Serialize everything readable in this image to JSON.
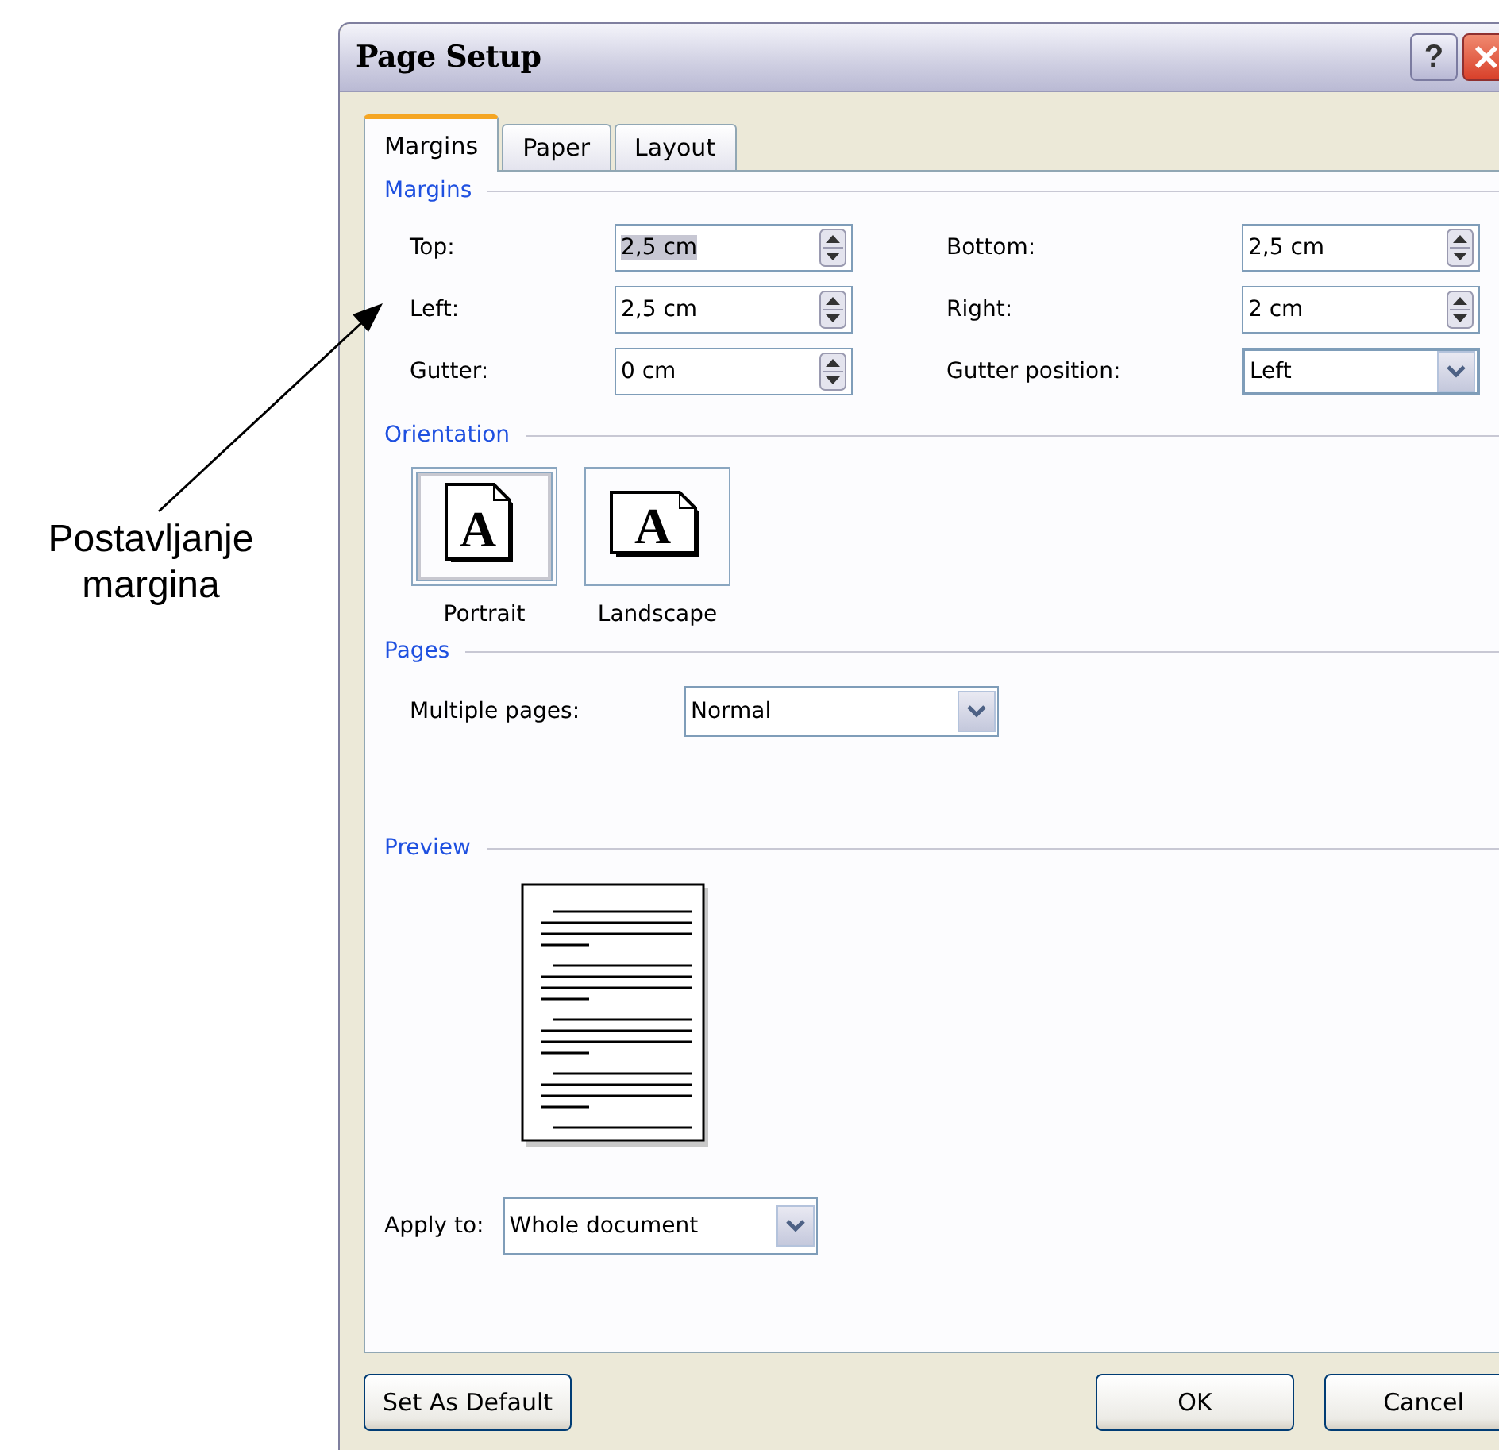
{
  "window": {
    "title": "Page Setup",
    "help_button": "?"
  },
  "tabs": [
    {
      "label": "Margins",
      "selected": true
    },
    {
      "label": "Paper",
      "selected": false
    },
    {
      "label": "Layout",
      "selected": false
    }
  ],
  "margins": {
    "title": "Margins",
    "fields": [
      {
        "label": "Top:",
        "value": "2,5 cm",
        "kind": "spin",
        "highlighted": true
      },
      {
        "label": "Bottom:",
        "value": "2,5 cm",
        "kind": "spin",
        "highlighted": false
      },
      {
        "label": "Left:",
        "value": "2,5 cm",
        "kind": "spin",
        "highlighted": false
      },
      {
        "label": "Right:",
        "value": "2 cm",
        "kind": "spin",
        "highlighted": false
      },
      {
        "label": "Gutter:",
        "value": "0 cm",
        "kind": "spin",
        "highlighted": false
      },
      {
        "label": "Gutter position:",
        "value": "Left",
        "kind": "dropdown",
        "highlighted": false
      }
    ]
  },
  "orientation": {
    "title": "Orientation",
    "options": [
      {
        "label": "Portrait",
        "icon_letter": "A",
        "kind": "portrait",
        "selected": true
      },
      {
        "label": "Landscape",
        "icon_letter": "A",
        "kind": "landscape",
        "selected": false
      }
    ]
  },
  "pages": {
    "title": "Pages",
    "label": "Multiple pages:",
    "value": "Normal"
  },
  "preview": {
    "title": "Preview"
  },
  "apply_to": {
    "label": "Apply to:",
    "value": "Whole document"
  },
  "buttons": [
    {
      "label": "Set As Default",
      "kind": "left"
    },
    {
      "label": "OK",
      "kind": "right"
    },
    {
      "label": "Cancel",
      "kind": "right"
    }
  ],
  "annotation": {
    "text": "Postavljanje margina"
  }
}
